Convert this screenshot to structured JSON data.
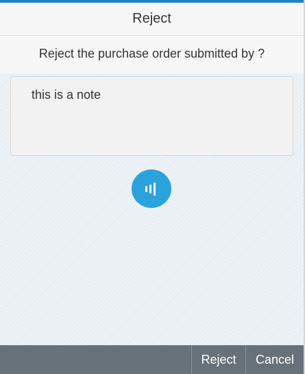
{
  "dialog": {
    "title": "Reject",
    "question": "Reject the purchase order submitted by ?",
    "note": {
      "value": "this is a note"
    },
    "voice_button": {
      "icon": "voice-input-icon"
    }
  },
  "footer": {
    "reject_label": "Reject",
    "cancel_label": "Cancel"
  },
  "colors": {
    "accent": "#1f83c6",
    "voice_button": "#2aa3dc",
    "footer_bar": "#66717a"
  }
}
